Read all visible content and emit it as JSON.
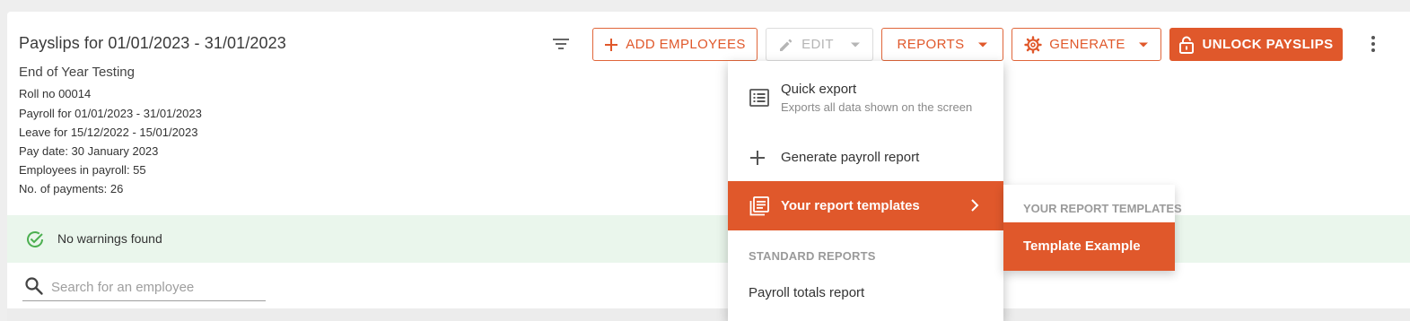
{
  "header": {
    "title": "Payslips for 01/01/2023 - 31/01/2023",
    "subtitle": "End of Year Testing",
    "info": [
      "Roll no 00014",
      "Payroll for 01/01/2023 - 31/01/2023",
      "Leave for 15/12/2022 - 15/01/2023",
      "Pay date: 30 January 2023",
      "Employees in payroll: 55",
      "No. of payments: 26"
    ]
  },
  "toolbar": {
    "add_employees": "ADD EMPLOYEES",
    "edit": "EDIT",
    "reports": "REPORTS",
    "generate": "GENERATE",
    "unlock_payslips": "UNLOCK PAYSLIPS"
  },
  "warnings": {
    "text": "No warnings found"
  },
  "search": {
    "placeholder": "Search for an employee",
    "value": ""
  },
  "reports_menu": {
    "quick_export_title": "Quick export",
    "quick_export_desc": "Exports all data shown on the screen",
    "generate_payroll_report": "Generate payroll report",
    "your_report_templates": "Your report templates",
    "standard_reports_heading": "STANDARD REPORTS",
    "payroll_totals_report": "Payroll totals report"
  },
  "templates_submenu": {
    "heading": "YOUR REPORT TEMPLATES",
    "items": [
      "Template Example"
    ]
  },
  "colors": {
    "accent": "#e0582b",
    "success_bg": "#eaf6ec",
    "success_icon": "#4caf50",
    "disabled": "#b5b5b5"
  },
  "icons": [
    "filter-icon",
    "plus-icon",
    "pencil-icon",
    "caret-down-icon",
    "gear-icon",
    "lock-icon",
    "more-vert-icon",
    "check-circle-icon",
    "search-icon",
    "list-icon",
    "plus-icon",
    "templates-icon",
    "chevron-right-icon"
  ]
}
